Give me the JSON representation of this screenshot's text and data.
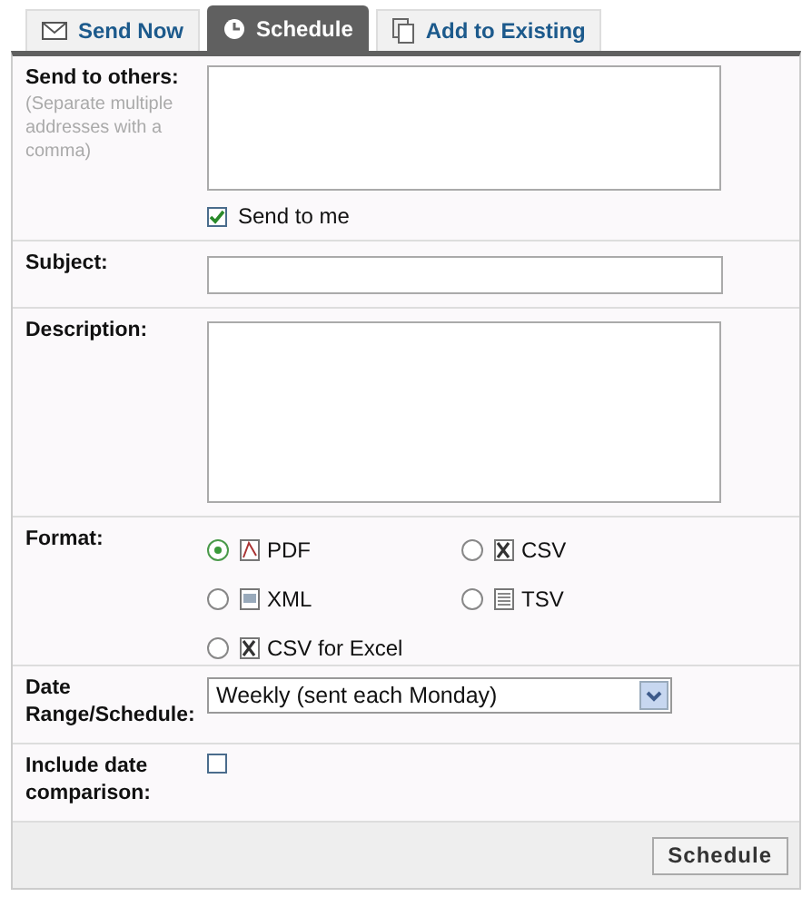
{
  "tabs": [
    {
      "label": "Send Now",
      "kind": "mail",
      "selected": false
    },
    {
      "label": "Schedule",
      "kind": "clock",
      "selected": true
    },
    {
      "label": "Add to Existing",
      "kind": "pages",
      "selected": false
    }
  ],
  "send_to_others": {
    "label": "Send to others:",
    "hint": "(Separate multiple addresses with a comma)",
    "send_to_me": {
      "label": "Send to me",
      "checked": true
    }
  },
  "subject": {
    "label": "Subject:"
  },
  "description": {
    "label": "Description:"
  },
  "format": {
    "label": "Format:",
    "options": [
      {
        "label": "PDF",
        "kind": "pdf",
        "selected": true
      },
      {
        "label": "CSV",
        "kind": "excel",
        "selected": false
      },
      {
        "label": "XML",
        "kind": "xml",
        "selected": false
      },
      {
        "label": "TSV",
        "kind": "text",
        "selected": false
      },
      {
        "label": "CSV for Excel",
        "kind": "excel",
        "selected": false
      }
    ]
  },
  "date_range": {
    "label": "Date Range/Schedule:",
    "value": "Weekly (sent each Monday)"
  },
  "include_date_comparison": {
    "label": "Include date comparison:",
    "checked": false
  },
  "button": "Schedule"
}
